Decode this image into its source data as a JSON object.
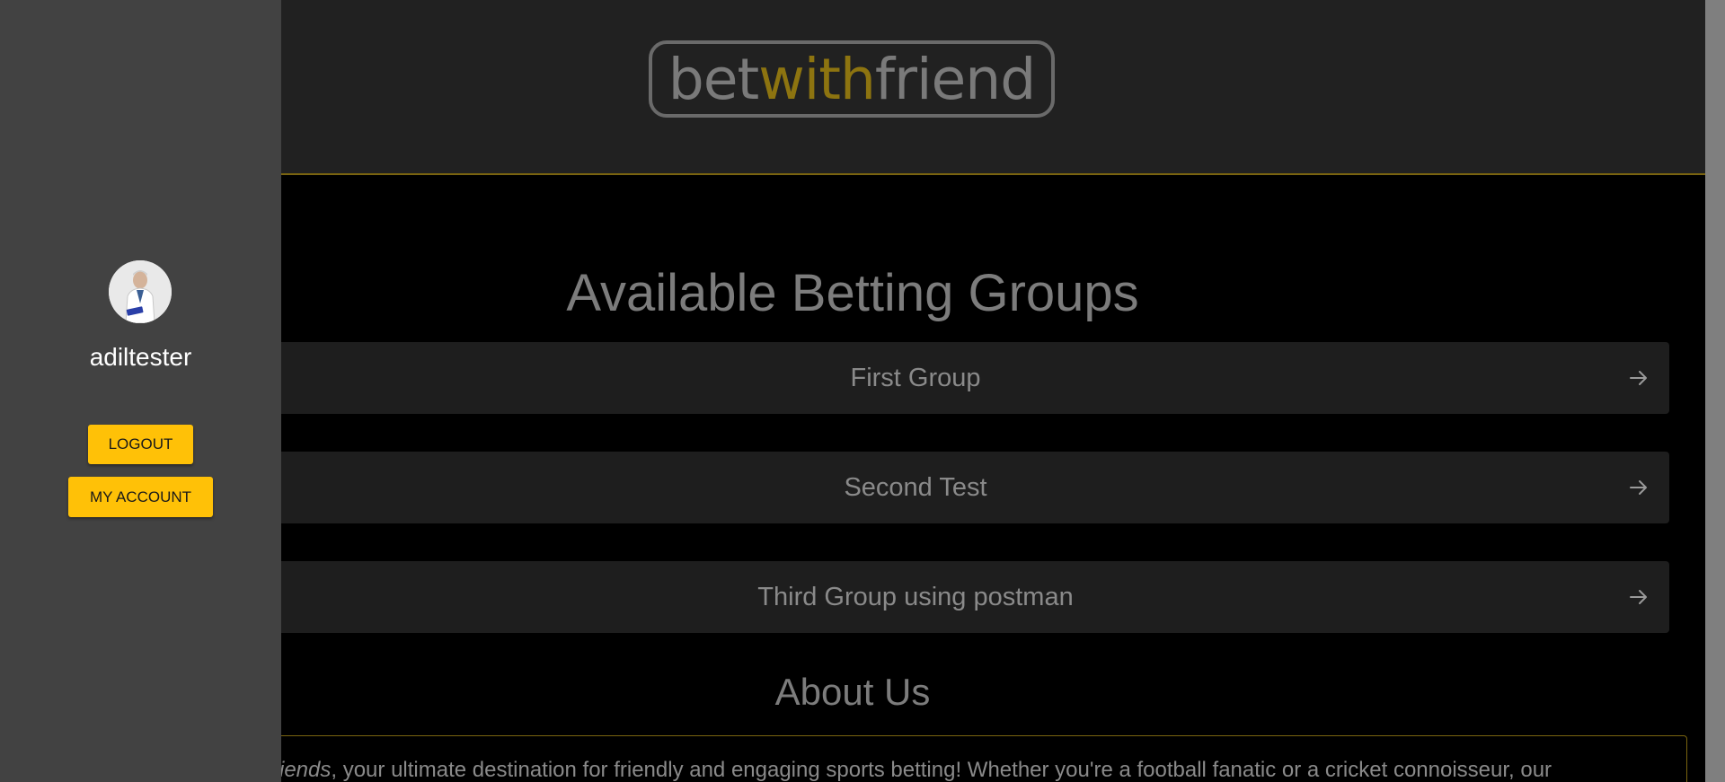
{
  "header": {
    "logo": {
      "part1": "bet",
      "part2": "with",
      "part3": "friend"
    }
  },
  "main": {
    "title": "Available Betting Groups",
    "groups": [
      {
        "label": "First Group"
      },
      {
        "label": "Second Test"
      },
      {
        "label": "Third Group using postman"
      }
    ],
    "about": {
      "title": "About Us",
      "text_em": "iends",
      "text_rest": ", your ultimate destination for friendly and engaging sports betting! Whether you're a football fanatic or a cricket connoisseur, our"
    }
  },
  "sidebar": {
    "username": "adiltester",
    "logout_label": "LOGOUT",
    "account_label": "MY ACCOUNT"
  },
  "colors": {
    "accent": "#ffc107",
    "logo_highlight": "#8d7410",
    "sidebar_bg": "#424242",
    "card_bg": "#1e1e1e"
  },
  "icons": {
    "group_arrow": "arrow-right-icon",
    "avatar": "avatar"
  }
}
